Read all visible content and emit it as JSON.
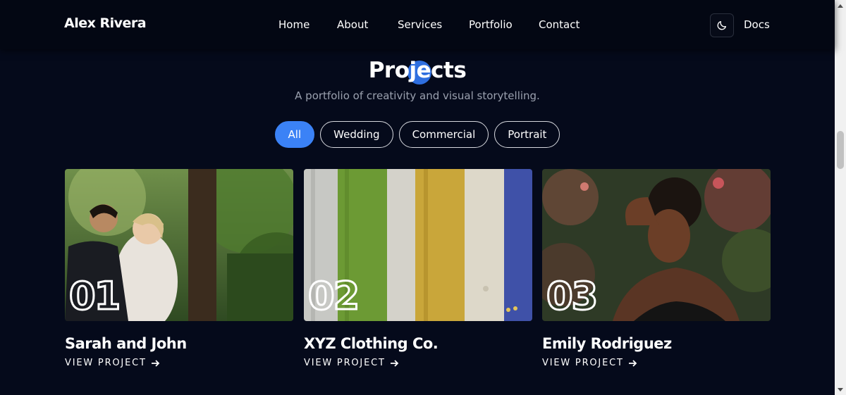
{
  "header": {
    "brand": "Alex Rivera",
    "nav": [
      {
        "label": "Home"
      },
      {
        "label": "About"
      },
      {
        "label": "Services"
      },
      {
        "label": "Portfolio"
      },
      {
        "label": "Contact"
      }
    ],
    "theme_icon": "moon-icon",
    "docs_label": "Docs"
  },
  "section": {
    "title": "Projects",
    "subtitle": "A portfolio of creativity and visual storytelling."
  },
  "filters": [
    {
      "label": "All",
      "active": true
    },
    {
      "label": "Wedding",
      "active": false
    },
    {
      "label": "Commercial",
      "active": false
    },
    {
      "label": "Portrait",
      "active": false
    }
  ],
  "projects": [
    {
      "number": "01",
      "title": "Sarah and John",
      "link": "VIEW PROJECT",
      "image_icon": "wedding-photo"
    },
    {
      "number": "02",
      "title": "XYZ Clothing Co.",
      "link": "VIEW PROJECT",
      "image_icon": "clothing-photo"
    },
    {
      "number": "03",
      "title": "Emily Rodriguez",
      "link": "VIEW PROJECT",
      "image_icon": "portrait-photo"
    }
  ],
  "colors": {
    "background": "#050a1b",
    "accent": "#3b82f6",
    "muted_text": "#9aa0ae"
  }
}
